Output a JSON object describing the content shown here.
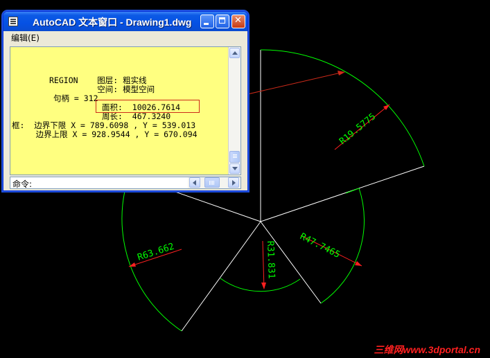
{
  "window": {
    "title": "AutoCAD 文本窗口 - Drawing1.dwg",
    "menu": {
      "edit": "编辑(E)"
    },
    "text_lines": [
      "REGION    图层: 粗实线",
      "          空间: 模型空间",
      "句柄 = 312",
      "面积:  10026.7614",
      "周长:  467.3240",
      "框:  边界下限 X = 789.6098 , Y = 539.013",
      "     边界上限 X = 928.9544 , Y = 670.094"
    ],
    "command_label": "命令:"
  },
  "drawing": {
    "dimensions": [
      "R19.5775",
      "R63.662",
      "R31.831",
      "R47.7465"
    ],
    "colors": {
      "background": "#000000",
      "arcs": "#00ff00",
      "lines": "#ffffff",
      "dimensions": "#ff2020",
      "dimension_text": "#00ff00"
    }
  },
  "watermark": "三维网www.3dportal.cn"
}
